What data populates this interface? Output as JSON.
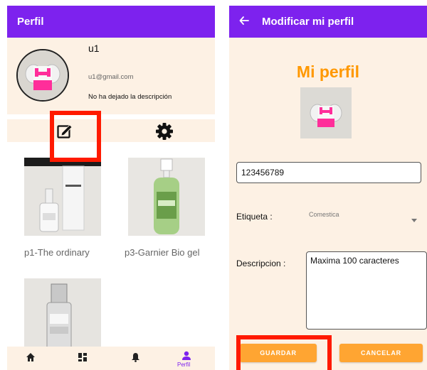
{
  "left_screen": {
    "appbar_title": "Perfil",
    "profile": {
      "username": "u1",
      "email": "u1@gmail.com",
      "description": "No ha dejado la descripción"
    },
    "actions": {
      "edit_icon": "edit-icon",
      "settings_icon": "gear-icon"
    },
    "products": [
      {
        "caption": "p1-The ordinary"
      },
      {
        "caption": "p3-Garnier Bio gel"
      },
      {
        "caption": ""
      }
    ],
    "bottom_nav": [
      {
        "icon": "home-icon",
        "label": ""
      },
      {
        "icon": "dashboard-icon",
        "label": ""
      },
      {
        "icon": "bell-icon",
        "label": ""
      },
      {
        "icon": "person-icon",
        "label": "Perfil"
      }
    ]
  },
  "right_screen": {
    "appbar_title": "Modificar mi perfil",
    "back_icon": "arrow-left-icon",
    "heading": "Mi perfil",
    "phone_value": "123456789",
    "tag_label": "Etiqueta :",
    "tag_value": "Comestica",
    "description_label": "Descripcion :",
    "description_placeholder": "Maxima 100 caracteres",
    "save_label": "GUARDAR",
    "cancel_label": "CANCELAR"
  },
  "colors": {
    "appbar": "#7d22ee",
    "card_bg": "#fdf1e4",
    "accent_orange": "#ff9800",
    "button_orange": "#ffa532",
    "highlight_red": "#ff1a00"
  }
}
